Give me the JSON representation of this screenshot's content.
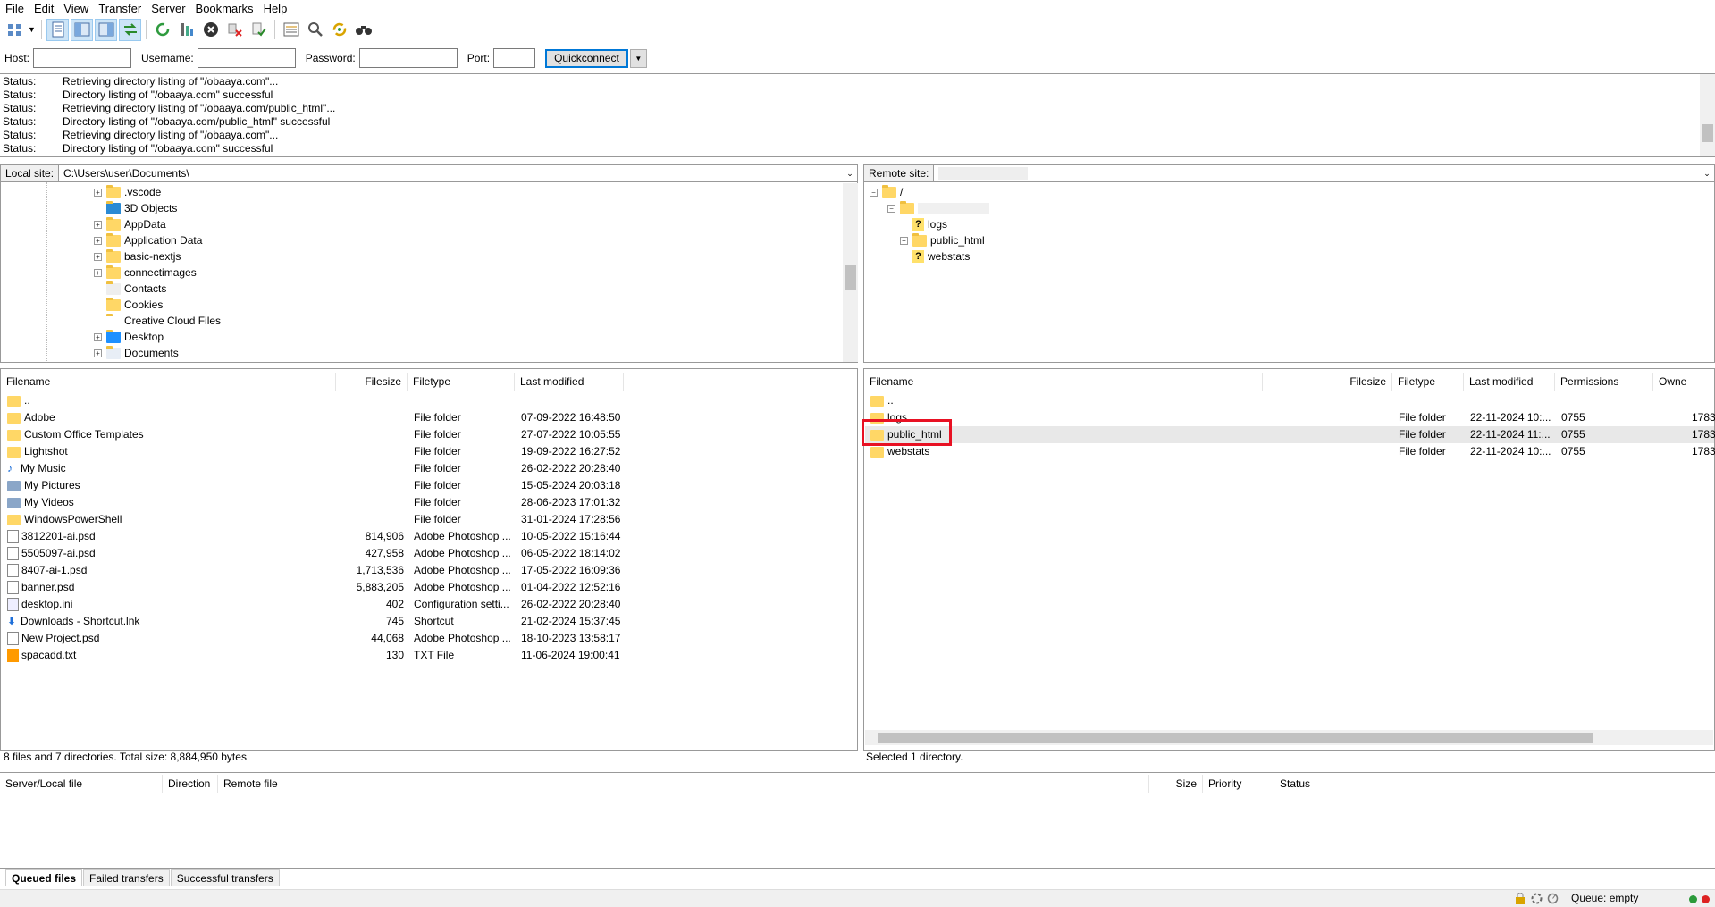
{
  "menu": [
    "File",
    "Edit",
    "View",
    "Transfer",
    "Server",
    "Bookmarks",
    "Help"
  ],
  "toolbar_icons": [
    "site-manager-icon",
    "dropdown-arrow-icon",
    "toggle-log-icon",
    "toggle-local-tree-icon",
    "toggle-remote-tree-icon",
    "toggle-queue-icon",
    "refresh-icon",
    "process-queue-icon",
    "cancel-icon",
    "disconnect-icon",
    "reconnect-icon",
    "filter-icon",
    "compare-icon",
    "sync-browse-icon",
    "search-icon"
  ],
  "quickconnect": {
    "host_label": "Host:",
    "username_label": "Username:",
    "password_label": "Password:",
    "port_label": "Port:",
    "host": "",
    "username": "",
    "password": "",
    "port": "",
    "button": "Quickconnect"
  },
  "log": [
    {
      "k": "Status:",
      "v": "Retrieving directory listing of \"/obaaya.com\"..."
    },
    {
      "k": "Status:",
      "v": "Directory listing of \"/obaaya.com\" successful"
    },
    {
      "k": "Status:",
      "v": "Retrieving directory listing of \"/obaaya.com/public_html\"..."
    },
    {
      "k": "Status:",
      "v": "Directory listing of \"/obaaya.com/public_html\" successful"
    },
    {
      "k": "Status:",
      "v": "Retrieving directory listing of \"/obaaya.com\"..."
    },
    {
      "k": "Status:",
      "v": "Directory listing of \"/obaaya.com\" successful"
    }
  ],
  "local": {
    "site_label": "Local site:",
    "path": "C:\\Users\\user\\Documents\\",
    "tree": [
      ".vscode",
      "3D Objects",
      "AppData",
      "Application Data",
      "basic-nextjs",
      "connectimages",
      "Contacts",
      "Cookies",
      "Creative Cloud Files",
      "Desktop",
      "Documents"
    ],
    "columns": [
      "Filename",
      "Filesize",
      "Filetype",
      "Last modified"
    ],
    "files": [
      {
        "name": "..",
        "size": "",
        "type": "",
        "mod": ""
      },
      {
        "name": "Adobe",
        "size": "",
        "type": "File folder",
        "mod": "07-09-2022 16:48:50"
      },
      {
        "name": "Custom Office Templates",
        "size": "",
        "type": "File folder",
        "mod": "27-07-2022 10:05:55"
      },
      {
        "name": "Lightshot",
        "size": "",
        "type": "File folder",
        "mod": "19-09-2022 16:27:52"
      },
      {
        "name": "My Music",
        "size": "",
        "type": "File folder",
        "mod": "26-02-2022 20:28:40"
      },
      {
        "name": "My Pictures",
        "size": "",
        "type": "File folder",
        "mod": "15-05-2024 20:03:18"
      },
      {
        "name": "My Videos",
        "size": "",
        "type": "File folder",
        "mod": "28-06-2023 17:01:32"
      },
      {
        "name": "WindowsPowerShell",
        "size": "",
        "type": "File folder",
        "mod": "31-01-2024 17:28:56"
      },
      {
        "name": "3812201-ai.psd",
        "size": "814,906",
        "type": "Adobe Photoshop ...",
        "mod": "10-05-2022 15:16:44"
      },
      {
        "name": "5505097-ai.psd",
        "size": "427,958",
        "type": "Adobe Photoshop ...",
        "mod": "06-05-2022 18:14:02"
      },
      {
        "name": "8407-ai-1.psd",
        "size": "1,713,536",
        "type": "Adobe Photoshop ...",
        "mod": "17-05-2022 16:09:36"
      },
      {
        "name": "banner.psd",
        "size": "5,883,205",
        "type": "Adobe Photoshop ...",
        "mod": "01-04-2022 12:52:16"
      },
      {
        "name": "desktop.ini",
        "size": "402",
        "type": "Configuration setti...",
        "mod": "26-02-2022 20:28:40"
      },
      {
        "name": "Downloads - Shortcut.lnk",
        "size": "745",
        "type": "Shortcut",
        "mod": "21-02-2024 15:37:45"
      },
      {
        "name": "New Project.psd",
        "size": "44,068",
        "type": "Adobe Photoshop ...",
        "mod": "18-10-2023 13:58:17"
      },
      {
        "name": "spacadd.txt",
        "size": "130",
        "type": "TXT File",
        "mod": "11-06-2024 19:00:41"
      }
    ],
    "status": "8 files and 7 directories. Total size: 8,884,950 bytes"
  },
  "remote": {
    "site_label": "Remote site:",
    "tree": [
      "/",
      "logs",
      "public_html",
      "webstats"
    ],
    "columns": [
      "Filename",
      "Filesize",
      "Filetype",
      "Last modified",
      "Permissions",
      "Owne"
    ],
    "files": [
      {
        "name": "..",
        "type": "",
        "mod": "",
        "perm": "",
        "owner": ""
      },
      {
        "name": "logs",
        "type": "File folder",
        "mod": "22-11-2024 10:...",
        "perm": "0755",
        "owner": "1783"
      },
      {
        "name": "public_html",
        "type": "File folder",
        "mod": "22-11-2024 11:...",
        "perm": "0755",
        "owner": "1783"
      },
      {
        "name": "webstats",
        "type": "File folder",
        "mod": "22-11-2024 10:...",
        "perm": "0755",
        "owner": "1783"
      }
    ],
    "status": "Selected 1 directory."
  },
  "queue": {
    "columns": [
      "Server/Local file",
      "Direction",
      "Remote file",
      "Size",
      "Priority",
      "Status"
    ],
    "tabs": [
      "Queued files",
      "Failed transfers",
      "Successful transfers"
    ],
    "status": "Queue: empty"
  },
  "colors": {
    "highlight": "#e81123",
    "selection": "#e8e8e8",
    "accent": "#0078d7"
  }
}
